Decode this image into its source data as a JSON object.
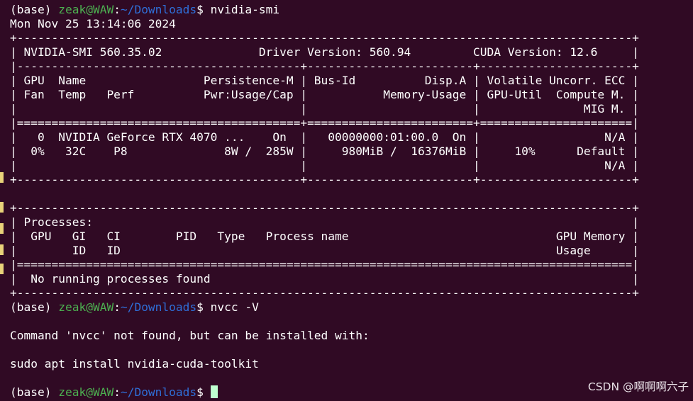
{
  "prompt": {
    "env": "(base) ",
    "user_host": "zeak@WAW",
    "colon": ":",
    "path": "~/Downloads",
    "dollar": "$ "
  },
  "lines": {
    "cmd1": "nvidia-smi",
    "date": "Mon Nov 25 13:14:06 2024",
    "sep_top": "+-----------------------------------------------------------------------------------------+",
    "header": "| NVIDIA-SMI 560.35.02              Driver Version: 560.94         CUDA Version: 12.6     |",
    "sep_sections": "|-----------------------------------------+------------------------+----------------------+",
    "col_hdr1": "| GPU  Name                 Persistence-M | Bus-Id          Disp.A | Volatile Uncorr. ECC |",
    "col_hdr2": "| Fan  Temp   Perf          Pwr:Usage/Cap |           Memory-Usage | GPU-Util  Compute M. |",
    "col_hdr3": "|                                         |                        |               MIG M. |",
    "sep_double": "|=========================================+========================+======================|",
    "gpu_row1": "|   0  NVIDIA GeForce RTX 4070 ...    On  |   00000000:01:00.0  On |                  N/A |",
    "gpu_row2": "|  0%   32C    P8              8W /  285W |     980MiB /  16376MiB |     10%      Default |",
    "gpu_row3": "|                                         |                        |                  N/A |",
    "sep_bottom": "+-----------------------------------------+------------------------+----------------------+",
    "blank": "",
    "proc_top": "+-----------------------------------------------------------------------------------------+",
    "proc_title": "| Processes:                                                                              |",
    "proc_hdr1": "|  GPU   GI   CI        PID   Type   Process name                              GPU Memory |",
    "proc_hdr2": "|        ID   ID                                                               Usage      |",
    "proc_double": "|=========================================================================================|",
    "proc_none": "|  No running processes found                                                             |",
    "proc_bottom": "+-----------------------------------------------------------------------------------------+",
    "cmd2": "nvcc -V",
    "not_found": "Command 'nvcc' not found, but can be installed with:",
    "install": "sudo apt install nvidia-cuda-toolkit"
  },
  "watermark": "CSDN @啊啊啊六子",
  "colors": {
    "background": "#300a24",
    "user_host": "#4caf50",
    "path": "#2f6fd8",
    "text": "#ffffff",
    "cursor": "#bfffd0"
  }
}
